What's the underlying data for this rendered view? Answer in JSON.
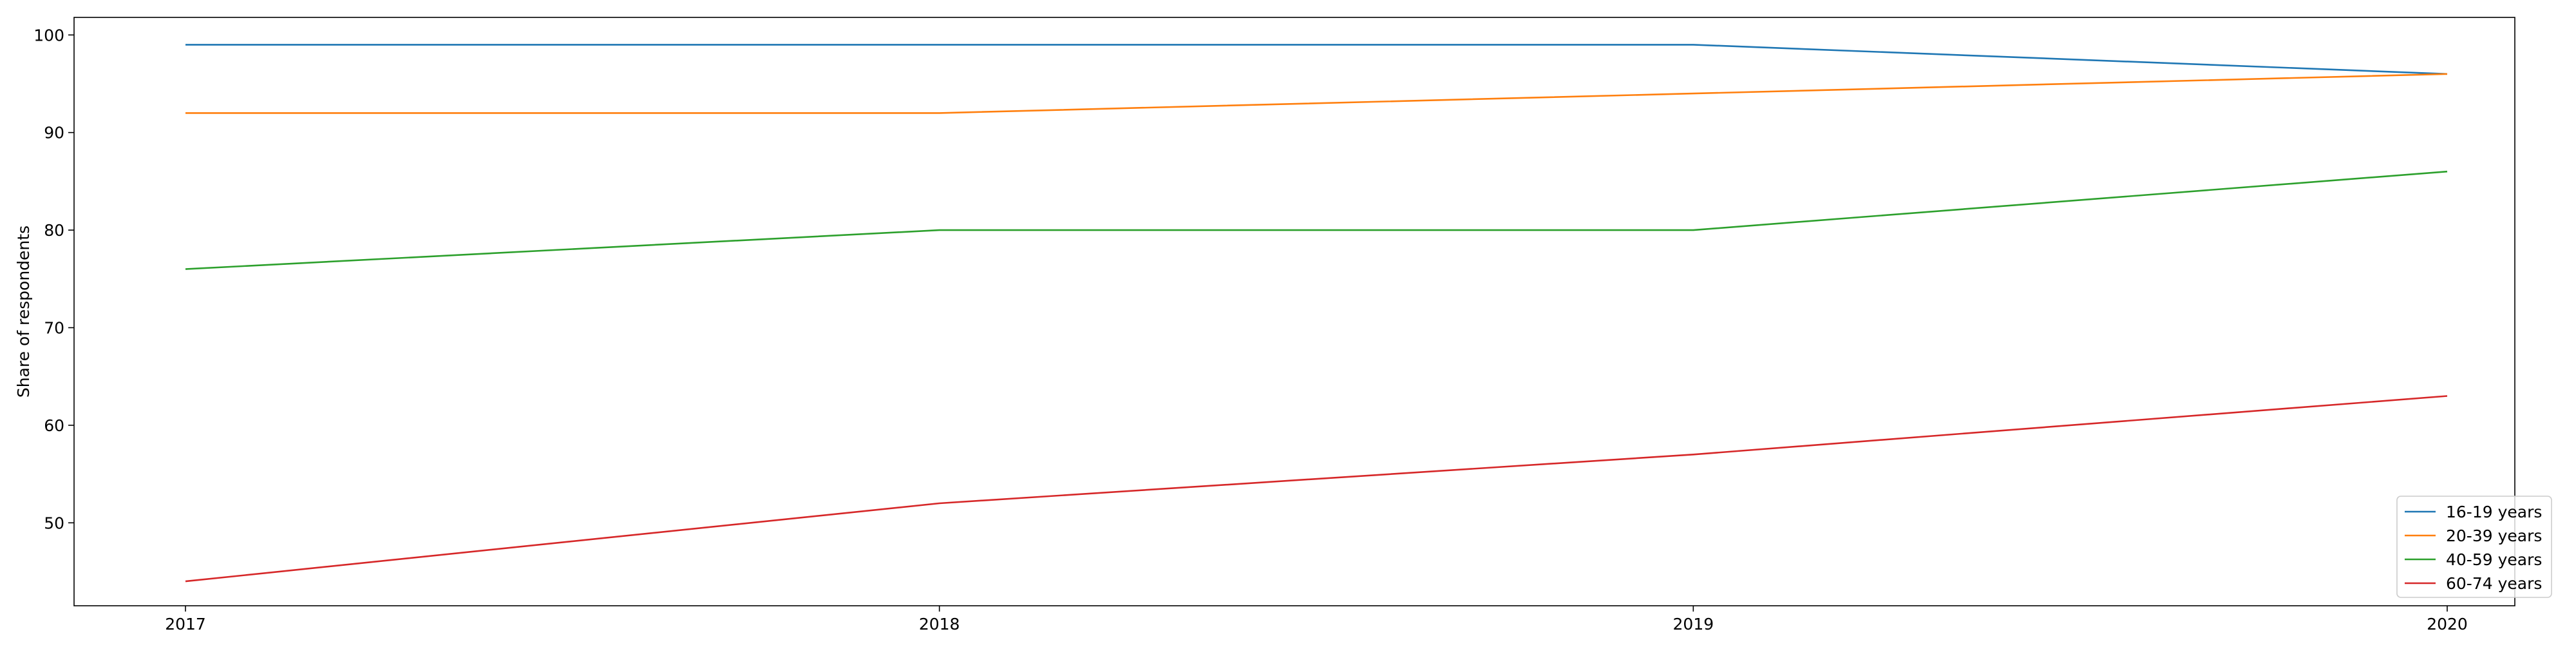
{
  "chart_data": {
    "type": "line",
    "x": [
      "2017",
      "2018",
      "2019",
      "2020"
    ],
    "ylabel": "Share of respondents",
    "xlabel": "",
    "ylim": [
      41.5,
      101.8
    ],
    "yticks": [
      50,
      60,
      70,
      80,
      90,
      100
    ],
    "grid": false,
    "legend_position": "bottom-right",
    "series": [
      {
        "name": "16-19 years",
        "color": "#1f77b4",
        "values": [
          99,
          99,
          99,
          96
        ]
      },
      {
        "name": "20-39 years",
        "color": "#ff7f0e",
        "values": [
          92,
          92,
          94,
          96
        ]
      },
      {
        "name": "40-59 years",
        "color": "#2ca02c",
        "values": [
          76,
          80,
          80,
          86
        ]
      },
      {
        "name": "60-74 years",
        "color": "#d62728",
        "values": [
          44,
          52,
          57,
          63
        ]
      }
    ]
  }
}
